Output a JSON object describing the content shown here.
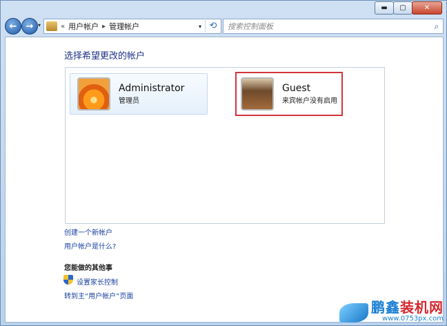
{
  "window": {
    "buttons": {
      "minimize": "▬",
      "maximize": "▢",
      "close": "✕"
    }
  },
  "nav": {
    "breadcrumb_prefix": "«",
    "breadcrumb": [
      "用户帐户",
      "管理帐户"
    ],
    "search_placeholder": "搜索控制面板"
  },
  "main": {
    "heading": "选择希望更改的帐户",
    "accounts": [
      {
        "name": "Administrator",
        "role": "管理员"
      },
      {
        "name": "Guest",
        "role": "来宾帐户没有启用"
      }
    ],
    "links": [
      "创建一个新帐户",
      "用户帐户是什么?"
    ],
    "other_heading": "您能做的其他事",
    "other_links": [
      "设置家长控制",
      "转到主“用户帐户”页面"
    ]
  },
  "watermark": {
    "title_blue": "鹏鑫",
    "title_red": "装机网",
    "url": "www.0753px.com"
  }
}
